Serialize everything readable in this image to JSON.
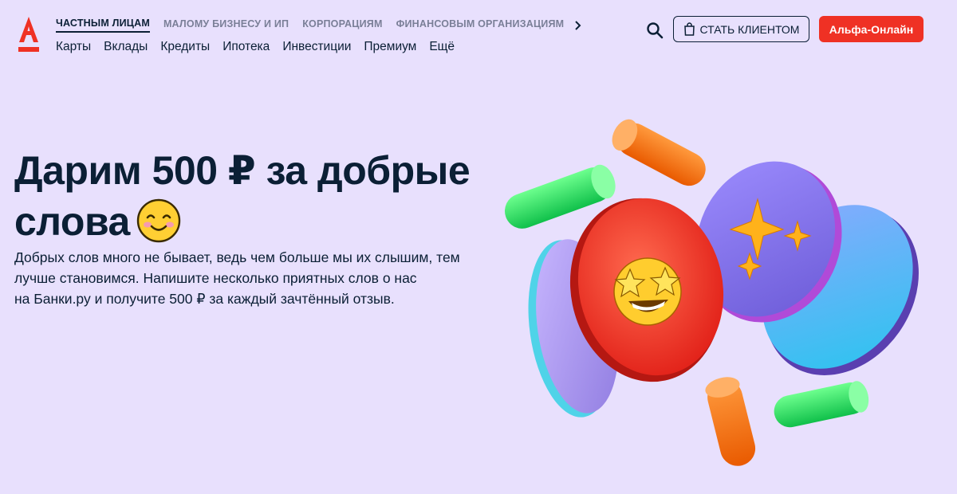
{
  "header": {
    "segments": [
      {
        "label": "Частным лицам",
        "active": true
      },
      {
        "label": "Малому бизнесу и ИП",
        "active": false
      },
      {
        "label": "Корпорациям",
        "active": false
      },
      {
        "label": "Финансовым организациям",
        "active": false
      }
    ],
    "nav": [
      "Карты",
      "Вклады",
      "Кредиты",
      "Ипотека",
      "Инвестиции",
      "Премиум",
      "Ещё"
    ],
    "become_client_label": "Стать клиентом",
    "online_label": "Альфа-Онлайн"
  },
  "hero": {
    "title_line1": "Дарим 500 ₽ за добрые",
    "title_line2": "слова",
    "description_line1": "Добрых слов много не бывает, ведь чем больше мы их слышим, тем",
    "description_line2": "лучше становимся. Напишите несколько приятных слов о нас",
    "description_line3": "на Банки.ру и получите 500 ₽ за каждый зачтённый отзыв."
  },
  "icons": {
    "logo": "alfa-bank-logo",
    "search": "search-icon",
    "bag": "shopping-bag-icon",
    "more": "chevron-right-icon",
    "emoji": "smiling-face-emoji"
  },
  "colors": {
    "brand_red": "#ef3124",
    "background": "#e8e0fd",
    "text": "#0b1f35",
    "muted": "#7a7f97"
  }
}
